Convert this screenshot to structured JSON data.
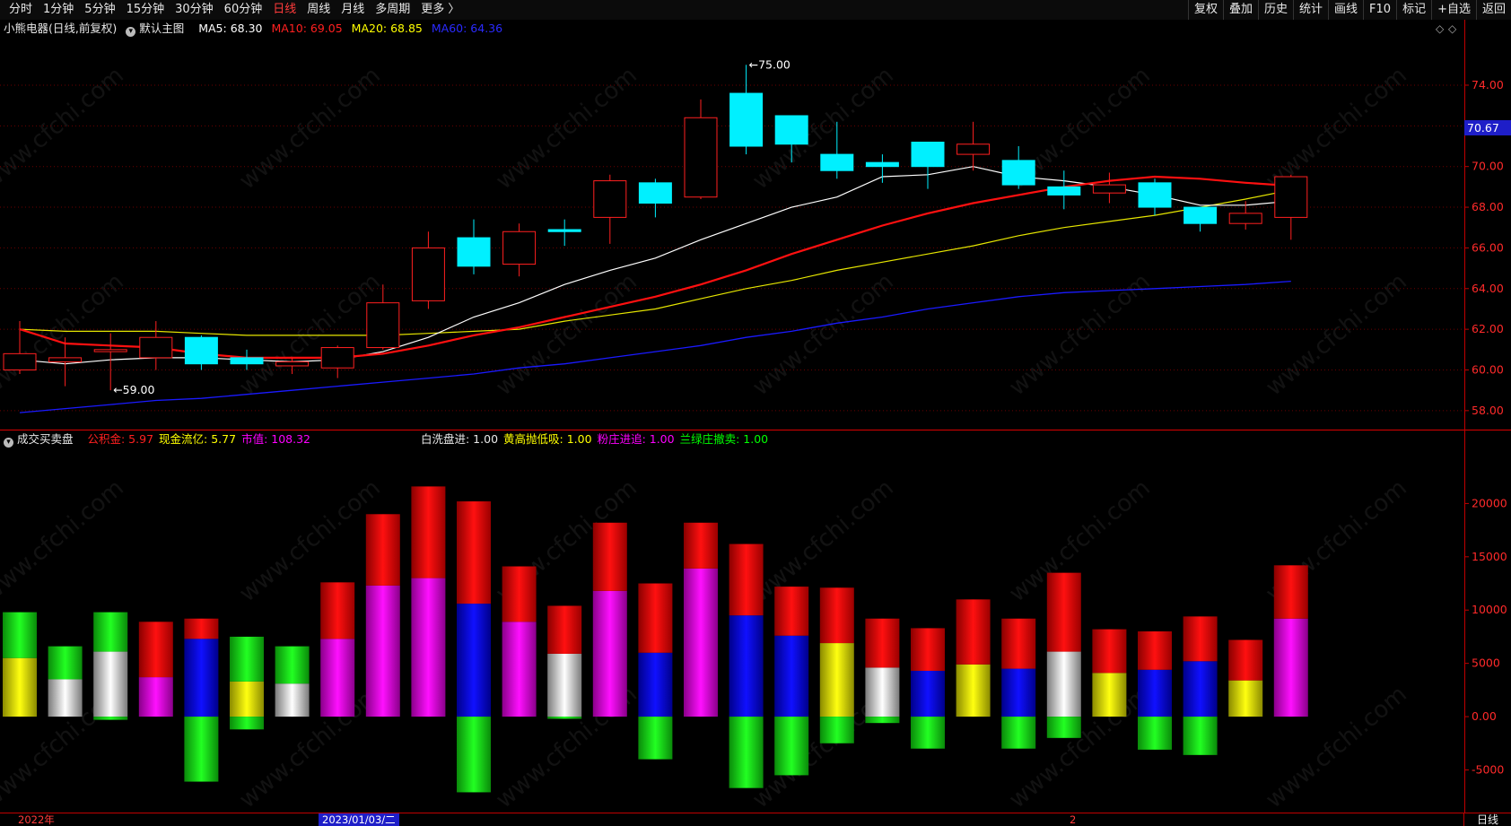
{
  "toolbar": {
    "tabs": [
      "分时",
      "1分钟",
      "5分钟",
      "15分钟",
      "30分钟",
      "60分钟",
      "日线",
      "周线",
      "月线",
      "多周期",
      "更多 〉"
    ],
    "active_tab": "日线",
    "tools": [
      "复权",
      "叠加",
      "历史",
      "统计",
      "画线",
      "F10",
      "标记",
      "+自选",
      "返回"
    ]
  },
  "main_legend": {
    "stock": "小熊电器(日线,前复权)",
    "template": "默认主图",
    "ma5": "MA5: 68.30",
    "ma10": "MA10: 69.05",
    "ma20": "MA20: 68.85",
    "ma60": "MA60: 64.36"
  },
  "sub_legend": {
    "name": "成交买卖盘",
    "items_left": [
      {
        "text": "公积金: 5.97",
        "color": "#ff2020"
      },
      {
        "text": "现金流亿: 5.77",
        "color": "#ffff00"
      },
      {
        "text": "市值: 108.32",
        "color": "#ff00ff"
      }
    ],
    "items_right": [
      {
        "text": "白洗盘进: 1.00",
        "color": "#e8e8e8"
      },
      {
        "text": "黄高抛低吸: 1.00",
        "color": "#ffff00"
      },
      {
        "text": "粉庄进追: 1.00",
        "color": "#ff00ff"
      },
      {
        "text": "兰绿庄撤卖: 1.00",
        "color": "#00ff00"
      }
    ]
  },
  "current_price_tag": "70.67",
  "bottom_bar": {
    "year_label": "2022年",
    "selected_date": "2023/01/03/二",
    "month_label": "2",
    "period": "日线"
  },
  "colors": {
    "up": "#ff2020",
    "down": "#00f0ff",
    "ma5": "#ffffff",
    "ma10": "#ff1010",
    "ma20": "#e6e600",
    "ma60": "#1a1aff",
    "axis": "#c00000"
  },
  "chart_data": [
    {
      "type": "candlestick",
      "y_ticks": [
        "74.00",
        "72.00",
        "70.00",
        "68.00",
        "66.00",
        "64.00",
        "62.00",
        "60.00",
        "58.00"
      ],
      "ylim": [
        57.2,
        76.6
      ],
      "annotations": [
        {
          "label": "75.00",
          "index": 16,
          "value": 75.0
        },
        {
          "label": "59.00",
          "index": 2,
          "value": 59.0
        }
      ],
      "candles": [
        {
          "o": 60.0,
          "h": 62.4,
          "l": 59.8,
          "c": 60.8
        },
        {
          "o": 60.4,
          "h": 61.6,
          "l": 59.2,
          "c": 60.6
        },
        {
          "o": 60.9,
          "h": 61.8,
          "l": 59.0,
          "c": 61.0
        },
        {
          "o": 60.6,
          "h": 62.4,
          "l": 60.0,
          "c": 61.6
        },
        {
          "o": 61.6,
          "h": 61.7,
          "l": 60.0,
          "c": 60.3
        },
        {
          "o": 60.6,
          "h": 61.0,
          "l": 60.0,
          "c": 60.3
        },
        {
          "o": 60.2,
          "h": 60.6,
          "l": 59.8,
          "c": 60.4
        },
        {
          "o": 60.1,
          "h": 61.2,
          "l": 59.6,
          "c": 61.1
        },
        {
          "o": 61.1,
          "h": 64.2,
          "l": 61.0,
          "c": 63.3
        },
        {
          "o": 63.4,
          "h": 66.8,
          "l": 63.0,
          "c": 66.0
        },
        {
          "o": 66.5,
          "h": 67.4,
          "l": 64.7,
          "c": 65.1
        },
        {
          "o": 65.2,
          "h": 67.2,
          "l": 64.6,
          "c": 66.8
        },
        {
          "o": 66.9,
          "h": 67.4,
          "l": 66.1,
          "c": 66.8
        },
        {
          "o": 67.5,
          "h": 69.6,
          "l": 66.2,
          "c": 69.3
        },
        {
          "o": 69.2,
          "h": 69.4,
          "l": 67.5,
          "c": 68.2
        },
        {
          "o": 68.5,
          "h": 73.3,
          "l": 68.4,
          "c": 72.4
        },
        {
          "o": 73.6,
          "h": 75.0,
          "l": 70.6,
          "c": 71.0
        },
        {
          "o": 72.5,
          "h": 72.5,
          "l": 70.2,
          "c": 71.1
        },
        {
          "o": 70.6,
          "h": 72.2,
          "l": 69.4,
          "c": 69.8
        },
        {
          "o": 70.2,
          "h": 70.6,
          "l": 69.2,
          "c": 70.0
        },
        {
          "o": 71.2,
          "h": 71.2,
          "l": 68.9,
          "c": 70.0
        },
        {
          "o": 70.6,
          "h": 72.2,
          "l": 69.8,
          "c": 71.1
        },
        {
          "o": 70.3,
          "h": 71.0,
          "l": 68.9,
          "c": 69.1
        },
        {
          "o": 69.0,
          "h": 69.8,
          "l": 67.9,
          "c": 68.6
        },
        {
          "o": 68.7,
          "h": 69.7,
          "l": 68.2,
          "c": 69.1
        },
        {
          "o": 69.2,
          "h": 69.4,
          "l": 67.6,
          "c": 68.0
        },
        {
          "o": 68.0,
          "h": 68.0,
          "l": 66.8,
          "c": 67.2
        },
        {
          "o": 67.2,
          "h": 68.3,
          "l": 66.9,
          "c": 67.7
        },
        {
          "o": 67.5,
          "h": 69.6,
          "l": 66.4,
          "c": 69.5
        }
      ],
      "ma5": [
        60.5,
        60.3,
        60.5,
        60.6,
        60.6,
        60.5,
        60.4,
        60.5,
        60.9,
        61.6,
        62.6,
        63.3,
        64.2,
        64.9,
        65.5,
        66.4,
        67.2,
        68.0,
        68.5,
        69.5,
        69.6,
        70.0,
        69.5,
        69.3,
        69.0,
        68.6,
        68.1,
        68.1,
        68.3
      ],
      "ma10": [
        62.0,
        61.3,
        61.2,
        61.1,
        60.8,
        60.6,
        60.6,
        60.6,
        60.8,
        61.2,
        61.7,
        62.1,
        62.6,
        63.1,
        63.6,
        64.2,
        64.9,
        65.7,
        66.4,
        67.1,
        67.7,
        68.2,
        68.6,
        69.0,
        69.3,
        69.5,
        69.4,
        69.2,
        69.05
      ],
      "ma20": [
        62.0,
        61.9,
        61.9,
        61.9,
        61.8,
        61.7,
        61.7,
        61.7,
        61.7,
        61.8,
        61.9,
        62.0,
        62.4,
        62.7,
        63.0,
        63.5,
        64.0,
        64.4,
        64.9,
        65.3,
        65.7,
        66.1,
        66.6,
        67.0,
        67.3,
        67.6,
        68.0,
        68.4,
        68.85
      ],
      "ma60": [
        57.9,
        58.1,
        58.3,
        58.5,
        58.6,
        58.8,
        59.0,
        59.2,
        59.4,
        59.6,
        59.8,
        60.1,
        60.3,
        60.6,
        60.9,
        61.2,
        61.6,
        61.9,
        62.3,
        62.6,
        63.0,
        63.3,
        63.6,
        63.8,
        63.9,
        64.0,
        64.1,
        64.2,
        64.36
      ]
    },
    {
      "type": "stacked-bar",
      "y_ticks": [
        "20000",
        "15000",
        "10000",
        "5000",
        "0.00",
        "-5000"
      ],
      "ylim": [
        -9000,
        25000
      ],
      "bars": [
        {
          "base": "yellow",
          "b": 5500,
          "t": 9800,
          "n": 0
        },
        {
          "base": "white",
          "b": 3500,
          "t": 6600,
          "n": 0
        },
        {
          "base": "white",
          "b": 6100,
          "t": 9800,
          "n": -300
        },
        {
          "base": "magenta",
          "b": 3700,
          "t": 8900,
          "n": 0
        },
        {
          "base": "blue",
          "b": 7300,
          "t": 9200,
          "n": -6100
        },
        {
          "base": "yellow",
          "b": 3300,
          "t": 7500,
          "n": -1200
        },
        {
          "base": "white",
          "b": 3100,
          "t": 6600,
          "n": 0
        },
        {
          "base": "magenta",
          "b": 7300,
          "t": 12600,
          "n": 0
        },
        {
          "base": "magenta",
          "b": 12300,
          "t": 19000,
          "n": 0
        },
        {
          "base": "magenta",
          "b": 13000,
          "t": 21600,
          "n": 0
        },
        {
          "base": "blue",
          "b": 10600,
          "t": 20200,
          "n": -7100
        },
        {
          "base": "magenta",
          "b": 8900,
          "t": 14100,
          "n": 0
        },
        {
          "base": "white",
          "b": 5900,
          "t": 10400,
          "n": -200
        },
        {
          "base": "magenta",
          "b": 11800,
          "t": 18200,
          "n": 0
        },
        {
          "base": "blue",
          "b": 6000,
          "t": 12500,
          "n": -4000
        },
        {
          "base": "magenta",
          "b": 13900,
          "t": 18200,
          "n": 0
        },
        {
          "base": "blue",
          "b": 9500,
          "t": 16200,
          "n": -6700
        },
        {
          "base": "blue",
          "b": 7600,
          "t": 12200,
          "n": -5500
        },
        {
          "base": "yellow",
          "b": 6900,
          "t": 12100,
          "n": -2500
        },
        {
          "base": "white",
          "b": 4600,
          "t": 9200,
          "n": -600
        },
        {
          "base": "blue",
          "b": 4300,
          "t": 8300,
          "n": -3000
        },
        {
          "base": "yellow",
          "b": 4900,
          "t": 11000,
          "n": 0
        },
        {
          "base": "blue",
          "b": 4500,
          "t": 9200,
          "n": -3000
        },
        {
          "base": "white",
          "b": 6100,
          "t": 13500,
          "n": -2000
        },
        {
          "base": "yellow",
          "b": 4100,
          "t": 8200,
          "n": 0
        },
        {
          "base": "blue",
          "b": 4400,
          "t": 8000,
          "n": -3100
        },
        {
          "base": "blue",
          "b": 5200,
          "t": 9400,
          "n": -3600
        },
        {
          "base": "yellow",
          "b": 3400,
          "t": 7200,
          "n": 0
        },
        {
          "base": "magenta",
          "b": 9200,
          "t": 14200,
          "n": 0
        }
      ]
    }
  ]
}
